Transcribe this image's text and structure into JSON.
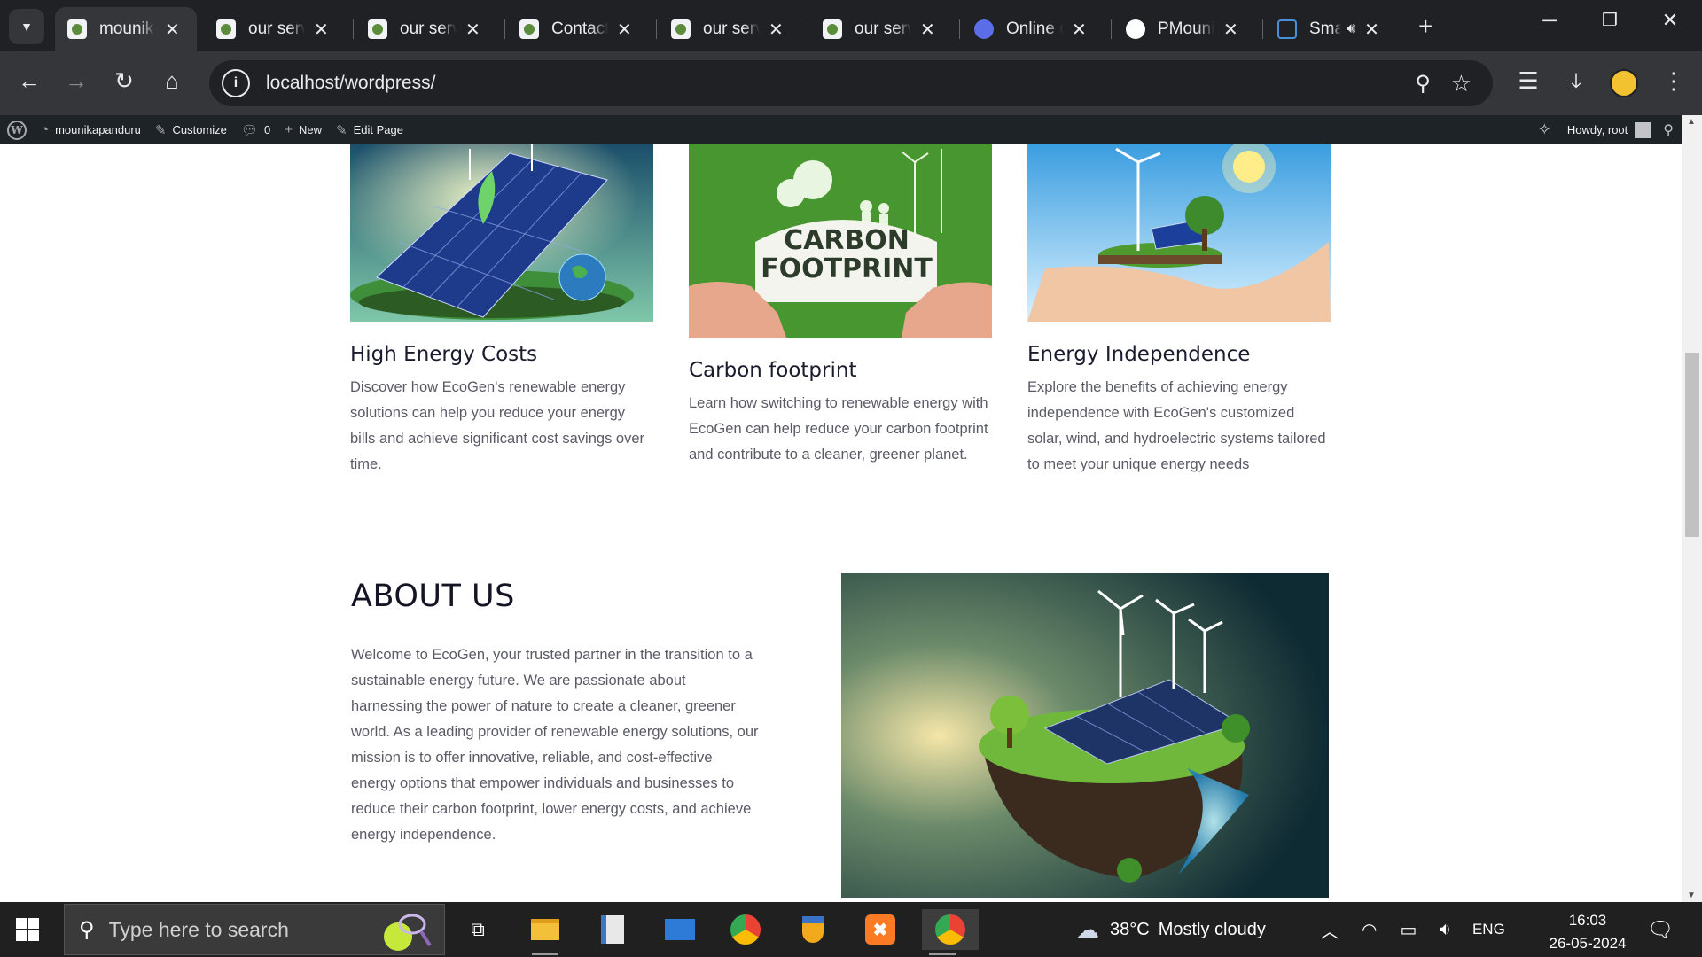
{
  "browser": {
    "tabs": [
      {
        "title": "mounik",
        "active": true
      },
      {
        "title": "our serv",
        "active": false
      },
      {
        "title": "our serv",
        "active": false
      },
      {
        "title": "Contact",
        "active": false
      },
      {
        "title": "our serv",
        "active": false
      },
      {
        "title": "our serv",
        "active": false
      },
      {
        "title": "Online (",
        "active": false
      },
      {
        "title": "PMouni",
        "active": false
      },
      {
        "title": "Sma",
        "active": false
      }
    ],
    "url": "localhost/wordpress/"
  },
  "wp_admin_bar": {
    "site_name": "mounikapanduru",
    "customize": "Customize",
    "comments_count": "0",
    "new_label": "New",
    "edit_page": "Edit Page",
    "howdy": "Howdy, root"
  },
  "cards": [
    {
      "title": "High Energy Costs",
      "text": "Discover how EcoGen's renewable energy solutions can help you reduce your energy bills and achieve significant cost savings over time.",
      "image": "solar-panel-island"
    },
    {
      "title": "Carbon footprint",
      "text": "Learn how switching to renewable energy with EcoGen can help reduce your carbon footprint and contribute to a cleaner, greener planet.",
      "image": "carbon-footprint-sign",
      "image_text_line1": "CARBON",
      "image_text_line2": "FOOTPRINT"
    },
    {
      "title": "Energy Independence",
      "text": "Explore the benefits of achieving energy independence with EcoGen's customized solar, wind, and hydroelectric systems tailored to meet your unique energy needs",
      "image": "hand-holding-windmill"
    }
  ],
  "about": {
    "heading": "ABOUT US",
    "text": "Welcome to EcoGen, your trusted partner in the transition to a sustainable energy future. We are passionate about harnessing the power of nature to create a cleaner, greener world. As a leading provider of renewable energy solutions, our mission is to offer innovative, reliable, and cost-effective energy options that empower individuals and businesses to reduce their carbon footprint, lower energy costs, and achieve energy independence.",
    "image": "planet-with-solar-and-wind"
  },
  "taskbar": {
    "search_placeholder": "Type here to search",
    "weather_temp": "38°C",
    "weather_desc": "Mostly cloudy",
    "language": "ENG",
    "time": "16:03",
    "date": "26-05-2024"
  },
  "colors": {
    "chrome_dark": "#202124",
    "chrome_toolbar": "#35363a",
    "wp_bar": "#1d2327",
    "taskbar": "#202020",
    "heading_text": "#1b1b2e",
    "body_text": "#5a5a66"
  }
}
